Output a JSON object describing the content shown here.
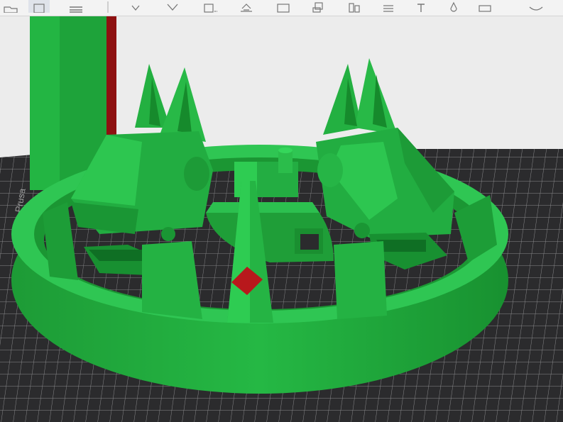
{
  "toolbar": {
    "buttons": [
      {
        "name": "open-tool-button",
        "icon": "folder-icon"
      },
      {
        "name": "list-tool-button",
        "icon": "list-icon",
        "selected": true
      },
      {
        "name": "menu-tool-button",
        "icon": "hamburger-icon"
      },
      {
        "name": "move-tool-button",
        "icon": "move-arrows-icon"
      },
      {
        "name": "rotate-tool-button",
        "icon": "rotate-icon"
      },
      {
        "name": "place-face-button",
        "icon": "place-on-face-icon"
      },
      {
        "name": "scale-tool-button",
        "icon": "scale-icon"
      },
      {
        "name": "cut-tool-button",
        "icon": "cut-icon"
      },
      {
        "name": "support-paint-button",
        "icon": "support-icon"
      },
      {
        "name": "seam-paint-button",
        "icon": "seam-icon"
      },
      {
        "name": "variable-layer-button",
        "icon": "layer-icon"
      },
      {
        "name": "text-tool-button",
        "icon": "text-icon"
      },
      {
        "name": "color-paint-button",
        "icon": "droplet-icon"
      },
      {
        "name": "measure-tool-button",
        "icon": "measure-icon"
      }
    ]
  },
  "colors": {
    "model_green": "#1fa83a",
    "model_green_light": "#2ecc52",
    "model_green_dark": "#128a2a",
    "highlight_red": "#b8181c",
    "bed_dark": "#2b2b2d",
    "bed_grid": "#8a8a8c",
    "background": "#ececec"
  },
  "bed": {
    "logo_text": "Prusa"
  }
}
